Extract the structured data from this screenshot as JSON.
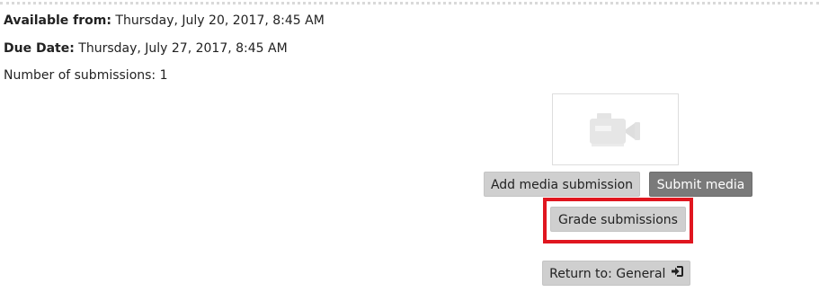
{
  "dates": {
    "available_label": "Available from:",
    "available_value": "Thursday, July 20, 2017, 8:45 AM",
    "due_label": "Due Date:",
    "due_value": "Thursday, July 27, 2017, 8:45 AM"
  },
  "submissions": {
    "count_text": "Number of submissions: 1"
  },
  "media": {
    "thumbnail_icon": "video-camera-icon"
  },
  "actions": {
    "add_media_label": "Add media submission",
    "submit_media_label": "Submit media",
    "grade_submissions_label": "Grade submissions",
    "return_label": "Return to: General",
    "return_icon": "sign-in-icon"
  },
  "colors": {
    "highlight": "#e0161f",
    "button_grey": "#cfcfcf",
    "button_dark": "#7a7a7a"
  }
}
